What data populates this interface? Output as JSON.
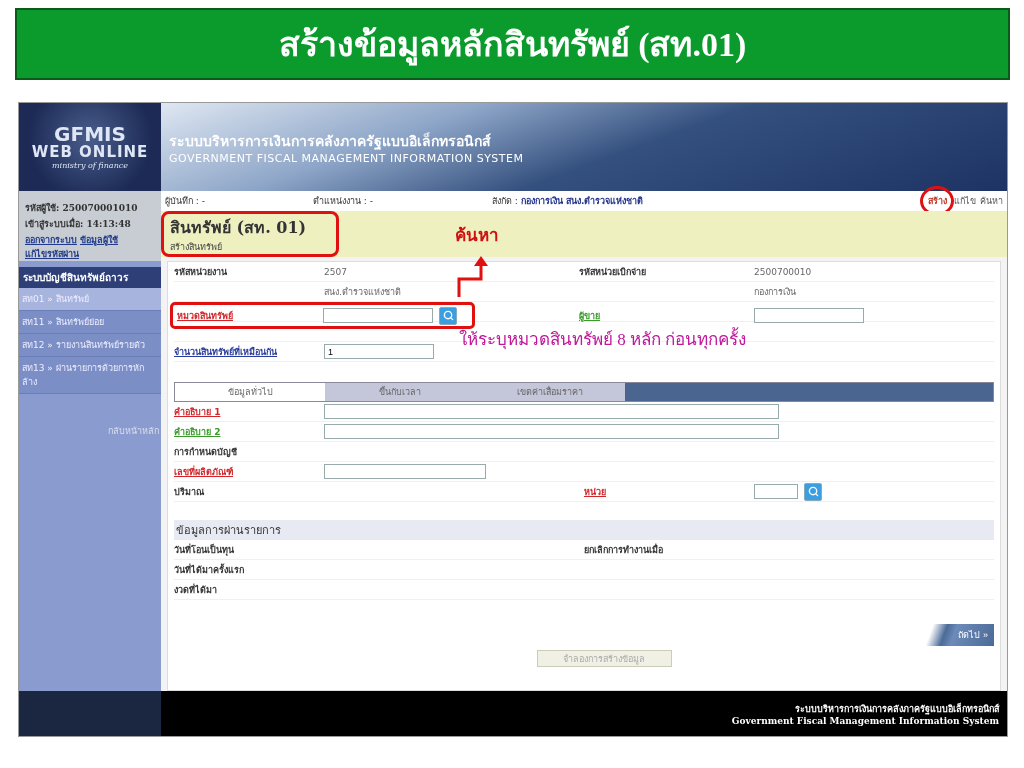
{
  "slide_title": "สร้างข้อมูลหลักสินทรัพย์ (สท.01)",
  "app": {
    "logo": {
      "line1": "GFMIS",
      "line2": "WEB ONLINE",
      "line3": "ministry of finance"
    },
    "header": {
      "title_th": "ระบบบริหารการเงินการคลังภาครัฐแบบอิเล็กทรอนิกส์",
      "title_en": "GOVERNMENT FISCAL MANAGEMENT INFORMATION SYSTEM"
    },
    "user_info": {
      "user_id": "รหัสผู้ใช้: 250070001010",
      "login_time": "เข้าสู่ระบบเมื่อ: 14:13:48",
      "links": [
        "ออกจากระบบ",
        "ข้อมูลผู้ใช้",
        "แก้ไขรหัสผ่าน"
      ]
    },
    "sidebar": {
      "section": "ระบบบัญชีสินทรัพย์ถาวร",
      "items": [
        {
          "label": "สท01 » สินทรัพย์",
          "selected": true
        },
        {
          "label": "สท11 » สินทรัพย์ย่อย",
          "selected": false
        },
        {
          "label": "สท12 » รายงานสินทรัพย์รายตัว",
          "selected": false
        },
        {
          "label": "สท13 » ผ่านรายการด้วยการหักล้าง",
          "selected": false
        }
      ],
      "back_link": "กลับหน้าหลัก"
    },
    "info_bar": {
      "recorder": "ผู้บันทึก : -",
      "position": "ตำแหน่งงาน : -",
      "affiliation_label": "สังกัด :",
      "affiliation": "กองการเงิน สนง.ตำรวจแห่งชาติ",
      "actions": [
        {
          "label": "สร้าง",
          "selected": true,
          "highlighted": true
        },
        {
          "label": "แก้ไข",
          "selected": false,
          "highlighted": false
        },
        {
          "label": "ค้นหา",
          "selected": false,
          "highlighted": false
        }
      ]
    },
    "page_title": "สินทรัพย์ (สท. 01)",
    "page_subtitle": "สร้างสินทรัพย์",
    "title_highlighted": true,
    "header_fields": [
      {
        "left": {
          "label": "รหัสหน่วยงาน",
          "kind": "plain",
          "value": "2507",
          "sub": "สนง.ตำรวจแห่งชาติ"
        },
        "right": {
          "label": "รหัสหน่วยเบิกจ่าย",
          "kind": "plain",
          "value": "2500700010",
          "sub": "กองการเงิน"
        }
      },
      {
        "left": {
          "label": "หมวดสินทรัพย์",
          "kind": "required",
          "input": {
            "kind": "short"
          },
          "search": true,
          "highlighted": true
        },
        "right": {
          "label": "ผู้ขาย",
          "kind": "optional",
          "input": {
            "kind": "short"
          }
        }
      },
      {
        "left": {
          "label": "จำนวนสินทรัพย์ที่เหมือนกัน",
          "kind": "lookup",
          "input": {
            "kind": "short",
            "value": "1"
          }
        }
      }
    ],
    "tabs": [
      {
        "label": "ข้อมูลทั่วไป",
        "selected": true
      },
      {
        "label": "ขึ้นกับเวลา",
        "selected": false
      },
      {
        "label": "เขตค่าเสื่อมราคา",
        "selected": false
      }
    ],
    "general_fields": [
      {
        "label": "คำอธิบาย 1",
        "kind": "required",
        "input": {
          "kind": "wide"
        }
      },
      {
        "label": "คำอธิบาย 2",
        "kind": "optional",
        "input": {
          "kind": "wide"
        }
      },
      {
        "label": "การกำหนดบัญชี",
        "kind": "plain"
      },
      {
        "label": "เลขที่ผลิตภัณฑ์",
        "kind": "required",
        "input": {
          "kind": "medium"
        }
      },
      {
        "label": "ปริมาณ",
        "kind": "plain",
        "right": {
          "label": "หน่วย",
          "kind": "required",
          "input": {
            "kind": "tiny"
          },
          "search": true
        }
      }
    ],
    "posting_section": {
      "title": "ข้อมูลการผ่านรายการ",
      "rows": [
        {
          "label": "วันที่โอนเป็นทุน",
          "right_label": "ยกเลิกการทำงานเมื่อ"
        },
        {
          "label": "วันที่ได้มาครั้งแรก"
        },
        {
          "label": "งวดที่ได้มา"
        }
      ]
    },
    "next_button": "ถัดไป »",
    "simulate_button": {
      "label": "จำลองการสร้างข้อมูล",
      "disabled": true
    },
    "footer": {
      "line1": "ระบบบริหารการเงินการคลังภาครัฐแบบอิเล็กทรอนิกส์",
      "line2": "Government Fiscal Management Information System"
    }
  },
  "annotations": {
    "search_label": "ค้นหา",
    "note": "ให้ระบุหมวดสินทรัพย์ 8 หลัก ก่อนทุกครั้ง"
  }
}
